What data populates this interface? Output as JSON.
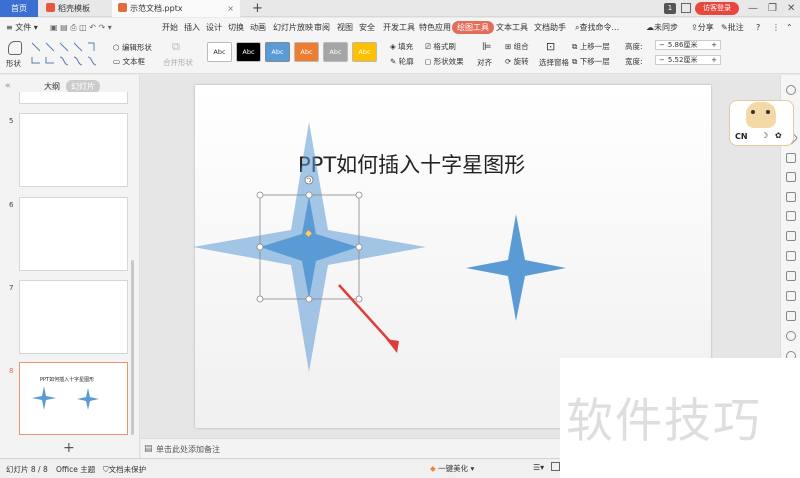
{
  "titlebar": {
    "home_tab": "首页",
    "template_tab": "稻壳模板",
    "doc_tab": "示范文档.pptx",
    "add_tab": "+",
    "badge": "1",
    "login": "访客登录",
    "win_min": "—",
    "win_max": "❐",
    "win_close": "✕"
  },
  "menubar": {
    "file": "文件",
    "items": [
      "开始",
      "插入",
      "设计",
      "切换",
      "动画",
      "幻灯片放映",
      "审阅",
      "视图",
      "安全",
      "开发工具",
      "特色应用"
    ],
    "active": "绘图工具",
    "items2": [
      "文本工具",
      "文档助手"
    ],
    "search": "查找命令...",
    "sync": "未同步",
    "share": "分享",
    "review": "批注"
  },
  "ribbon": {
    "shape": "形状",
    "edit_shape": "编辑形状",
    "text_box": "文本框",
    "merge_shape": "合并形状",
    "styles": [
      {
        "label": "Abc",
        "bg": "#ffffff",
        "fg": "#333333"
      },
      {
        "label": "Abc",
        "bg": "#000000",
        "fg": "#ffffff"
      },
      {
        "label": "Abc",
        "bg": "#5b9bd5",
        "fg": "#ffffff"
      },
      {
        "label": "Abc",
        "bg": "#ed7d31",
        "fg": "#ffffff"
      },
      {
        "label": "Abc",
        "bg": "#a5a5a5",
        "fg": "#ffffff"
      },
      {
        "label": "Abc",
        "bg": "#ffc000",
        "fg": "#ffffff"
      }
    ],
    "fill": "填充",
    "format_brush": "格式刷",
    "outline": "轮廓",
    "shape_effect": "形状效果",
    "align": "对齐",
    "group": "组合",
    "rotate": "旋转",
    "selection_pane": "选择窗格",
    "bring_forward": "上移一层",
    "send_backward": "下移一层",
    "height_label": "高度:",
    "height_value": "5.86厘米",
    "width_label": "宽度:",
    "width_value": "5.52厘米"
  },
  "leftpanel": {
    "tab_outline": "大纲",
    "tab_slides": "幻灯片",
    "slide_numbers": [
      "5",
      "6",
      "7",
      "8"
    ],
    "thumb8_title": "PPT如何插入十字星图形",
    "add": "+"
  },
  "slide": {
    "title": "PPT如何插入十字星图形"
  },
  "notes": {
    "placeholder": "单击此处添加备注"
  },
  "statusbar": {
    "slide_info": "幻灯片 8 / 8",
    "theme": "Office 主题",
    "protect": "文档未保护",
    "beautify": "一键美化"
  },
  "widget": {
    "label": "CN"
  },
  "watermark": {
    "text": "软件技巧"
  },
  "colors": {
    "accent": "#e36d59",
    "home_tab": "#3b6fd1",
    "login": "#e8473f",
    "star_fill": "#5b9bd5",
    "arrow": "#e03c3c"
  }
}
